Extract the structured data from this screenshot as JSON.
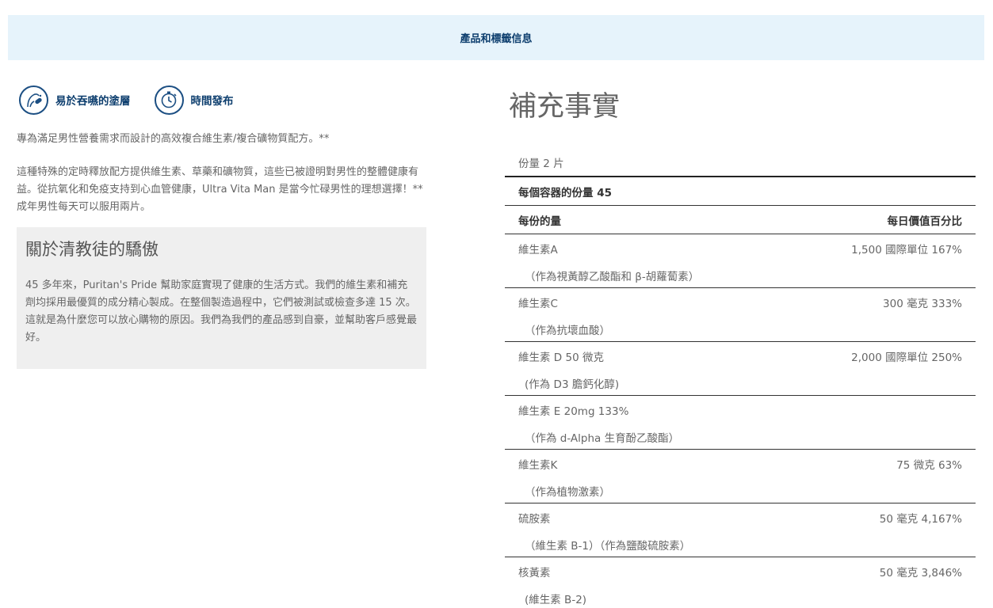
{
  "header": {
    "title": "產品和標籤信息"
  },
  "badges": [
    {
      "label": "易於吞嚥的塗層",
      "icon": "swallow-icon"
    },
    {
      "label": "時間發布",
      "icon": "timer-icon"
    }
  ],
  "intro": "專為滿足男性營養需求而設計的高效複合維生素/複合礦物質配方。**",
  "description": "這種特殊的定時釋放配方提供維生素、草藥和礦物質，這些已被證明對男性的整體健康有益。從抗氧化和免疫支持到心血管健康，Ultra Vita Man 是當今忙碌男性的理想選擇！** 成年男性每天可以服用兩片。",
  "pride": {
    "title": "關於清教徒的驕傲",
    "body": "45 多年來，Puritan's Pride 幫助家庭實現了健康的生活方式。我們的維生素和補充劑均採用最優質的成分精心製成。在整個製造過程中，它們被測試或檢查多達 15 次。這就是為什麼您可以放心購物的原因。我們為我們的產品感到自豪，並幫助客戶感覺最好。"
  },
  "facts": {
    "title": "補充事實",
    "serving_size": "份量 2 片",
    "servings_per_container": "每個容器的份量 45",
    "col_amount": "每份的量",
    "col_dv": "每日價值百分比",
    "rows": [
      {
        "name": "維生素A",
        "amount": "1,500 國際單位 167%",
        "sub": "（作為視黃醇乙酸酯和 β-胡蘿蔔素）"
      },
      {
        "name": "維生素C",
        "amount": "300 毫克 333%",
        "sub": "（作為抗壞血酸）"
      },
      {
        "name": "維生素 D 50 微克",
        "amount": "2,000 國際單位 250%",
        "sub": "(作為 D3 膽鈣化醇)"
      },
      {
        "name": "維生素 E 20mg 133%",
        "amount": "",
        "sub": "（作為 d-Alpha 生育酚乙酸酯）"
      },
      {
        "name": "維生素K",
        "amount": "75 微克 63%",
        "sub": "（作為植物激素）"
      },
      {
        "name": "硫胺素",
        "amount": "50 毫克 4,167%",
        "sub": "（維生素 B-1）（作為鹽酸硫胺素）"
      },
      {
        "name": "核黃素",
        "amount": "50 毫克 3,846%",
        "sub": "(維生素 B-2)"
      }
    ]
  }
}
